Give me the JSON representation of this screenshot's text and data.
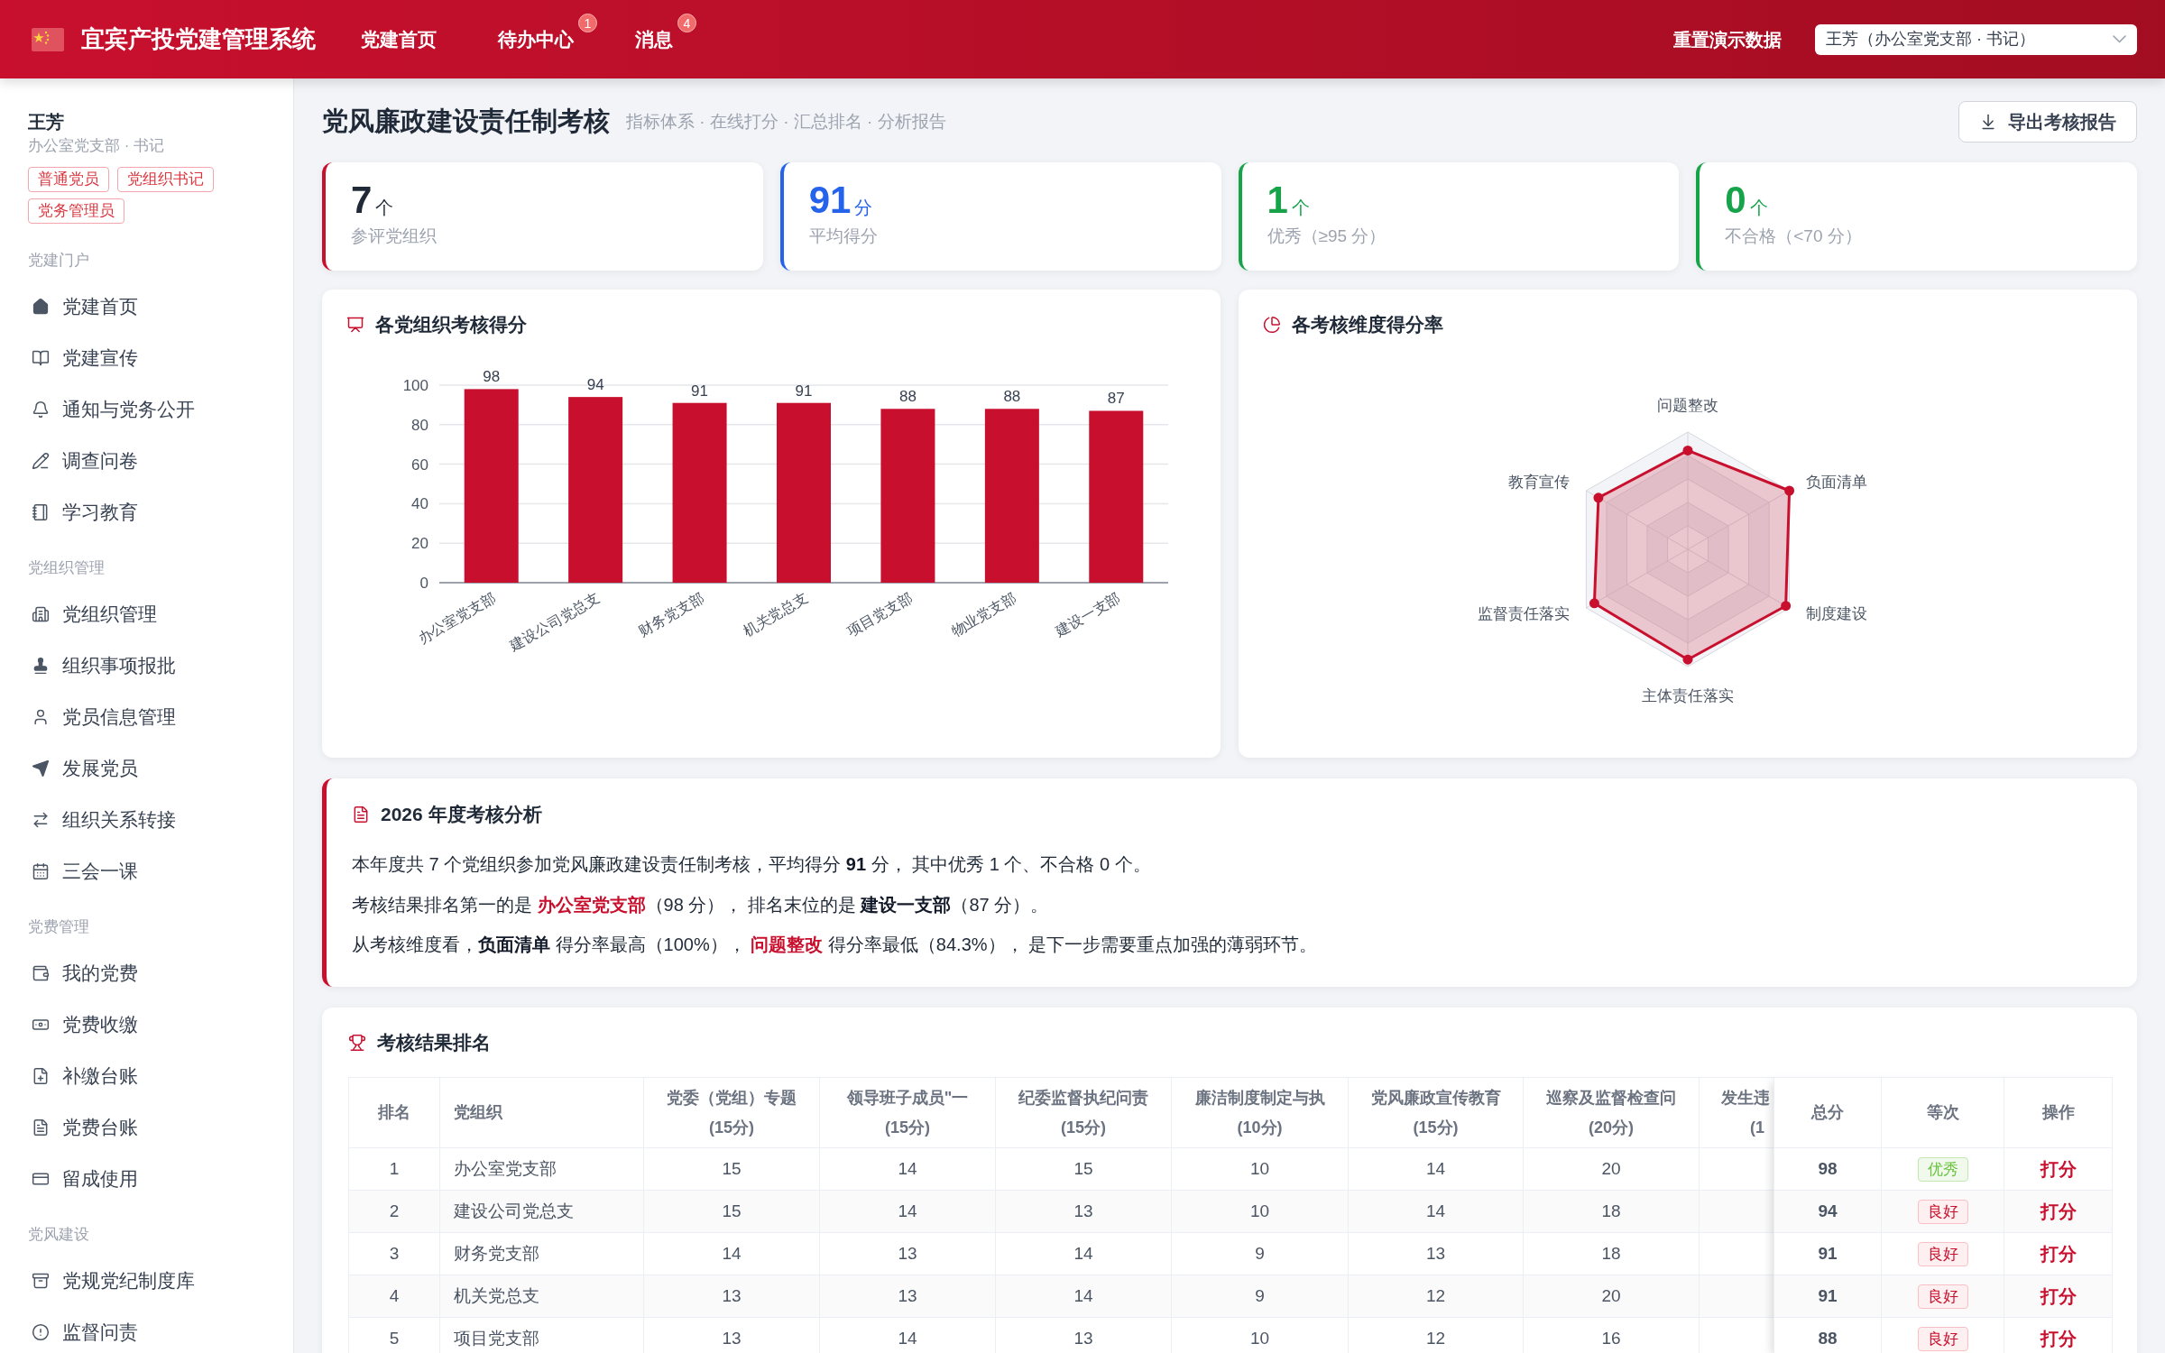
{
  "header": {
    "title": "宜宾产投党建管理系统",
    "nav": [
      {
        "label": "党建首页"
      },
      {
        "label": "待办中心",
        "badge": "1"
      },
      {
        "label": "消息",
        "badge": "4"
      }
    ],
    "reset_button": "重置演示数据",
    "user_select": {
      "value": "王芳（办公室党支部 · 书记）"
    }
  },
  "sidebar": {
    "user": {
      "name": "王芳",
      "subtitle": "办公室党支部 · 书记",
      "roles": [
        "普通党员",
        "党组织书记",
        "党务管理员"
      ]
    },
    "sections": [
      {
        "title": "党建门户",
        "items": [
          {
            "label": "党建首页"
          },
          {
            "label": "党建宣传"
          },
          {
            "label": "通知与党务公开"
          },
          {
            "label": "调查问卷"
          },
          {
            "label": "学习教育"
          }
        ]
      },
      {
        "title": "党组织管理",
        "items": [
          {
            "label": "党组织管理"
          },
          {
            "label": "组织事项报批"
          },
          {
            "label": "党员信息管理"
          },
          {
            "label": "发展党员"
          },
          {
            "label": "组织关系转接"
          },
          {
            "label": "三会一课"
          }
        ]
      },
      {
        "title": "党费管理",
        "items": [
          {
            "label": "我的党费"
          },
          {
            "label": "党费收缴"
          },
          {
            "label": "补缴台账"
          },
          {
            "label": "党费台账"
          },
          {
            "label": "留成使用"
          }
        ]
      },
      {
        "title": "党风建设",
        "items": [
          {
            "label": "党规党纪制度库"
          },
          {
            "label": "监督问责"
          }
        ]
      }
    ]
  },
  "page": {
    "title": "党风廉政建设责任制考核",
    "subtitle": "指标体系 · 在线打分 · 汇总排名 · 分析报告",
    "export_button": "导出考核报告"
  },
  "stats": [
    {
      "value": "7",
      "unit": "个",
      "label": "参评党组织",
      "color": "#c8102e",
      "kind": "plain"
    },
    {
      "value": "91",
      "unit": "分",
      "label": "平均得分",
      "color": "#2563eb",
      "kind": "accent"
    },
    {
      "value": "1",
      "unit": "个",
      "label": "优秀（≥95 分）",
      "color": "#16a34a",
      "kind": "accent"
    },
    {
      "value": "0",
      "unit": "个",
      "label": "不合格（<70 分）",
      "color": "#16a34a",
      "kind": "accent"
    }
  ],
  "score_chart": {
    "title": "各党组织考核得分",
    "chart_data": {
      "type": "bar",
      "categories": [
        "办公室党支部",
        "建设公司党总支",
        "财务党支部",
        "机关党总支",
        "项目党支部",
        "物业党支部",
        "建设一支部"
      ],
      "series": [
        {
          "color": "#c8102e",
          "values": [
            98,
            94,
            91,
            91,
            88,
            88,
            87
          ]
        }
      ],
      "ylim": [
        0,
        100
      ],
      "yticks": [
        0,
        20,
        40,
        60,
        80,
        100
      ],
      "grid": true,
      "data_labels": true
    }
  },
  "dimension_chart": {
    "title": "各考核维度得分率",
    "axes": [
      "问题整改",
      "负面清单",
      "制度建设",
      "主体责任落实",
      "监督责任落实",
      "教育宣传"
    ]
  },
  "analysis": {
    "title": "2026 年度考核分析",
    "paragraphs": [
      [
        {
          "text": "本年度共 7 个党组织参加党风廉政建设责任制考核，平均得分 ",
          "kind": "plain"
        },
        {
          "text": "91",
          "kind": "bold"
        },
        {
          "text": " 分， 其中优秀 1 个、不合格 0 个。",
          "kind": "plain"
        }
      ],
      [
        {
          "text": "考核结果排名第一的是 ",
          "kind": "plain"
        },
        {
          "text": "办公室党支部",
          "kind": "highlight"
        },
        {
          "text": "（98 分）， 排名末位的是 ",
          "kind": "plain"
        },
        {
          "text": "建设一支部",
          "kind": "bold"
        },
        {
          "text": "（87 分）。",
          "kind": "plain"
        }
      ],
      [
        {
          "text": "从考核维度看，",
          "kind": "plain"
        },
        {
          "text": "负面清单",
          "kind": "bold"
        },
        {
          "text": " 得分率最高（100%）， ",
          "kind": "plain"
        },
        {
          "text": "问题整改",
          "kind": "highlight"
        },
        {
          "text": " 得分率最低（84.3%）， 是下一步需要重点加强的薄弱环节。",
          "kind": "plain"
        }
      ]
    ]
  },
  "ranking": {
    "title": "考核结果排名",
    "columns": [
      {
        "label": "排名"
      },
      {
        "label": "党组织"
      },
      {
        "label": "党委（党组）专题",
        "note": "(15分)"
      },
      {
        "label": "领导班子成员\"一",
        "note": "(15分)"
      },
      {
        "label": "纪委监督执纪问责",
        "note": "(15分)"
      },
      {
        "label": "廉洁制度制定与执",
        "note": "(10分)"
      },
      {
        "label": "党风廉政宣传教育",
        "note": "(15分)"
      },
      {
        "label": "巡察及监督检查问",
        "note": "(20分)"
      },
      {
        "label": "发生违",
        "note": "(1"
      }
    ],
    "pinned_columns": [
      {
        "label": "总分"
      },
      {
        "label": "等次"
      },
      {
        "label": "操作"
      }
    ],
    "rows": [
      {
        "rank": "1",
        "org": "办公室党支部",
        "scores": [
          "15",
          "14",
          "15",
          "10",
          "14",
          "20"
        ],
        "total": "98",
        "grade": {
          "text": "优秀",
          "kind": "excellent"
        },
        "action": "打分"
      },
      {
        "rank": "2",
        "org": "建设公司党总支",
        "scores": [
          "15",
          "14",
          "13",
          "10",
          "14",
          "18"
        ],
        "total": "94",
        "grade": {
          "text": "良好",
          "kind": "good"
        },
        "action": "打分"
      },
      {
        "rank": "3",
        "org": "财务党支部",
        "scores": [
          "14",
          "13",
          "14",
          "9",
          "13",
          "18"
        ],
        "total": "91",
        "grade": {
          "text": "良好",
          "kind": "good"
        },
        "action": "打分"
      },
      {
        "rank": "4",
        "org": "机关党总支",
        "scores": [
          "13",
          "13",
          "14",
          "9",
          "12",
          "20"
        ],
        "total": "91",
        "grade": {
          "text": "良好",
          "kind": "good"
        },
        "action": "打分"
      },
      {
        "rank": "5",
        "org": "项目党支部",
        "scores": [
          "13",
          "14",
          "13",
          "10",
          "12",
          "16"
        ],
        "total": "88",
        "grade": {
          "text": "良好",
          "kind": "good"
        },
        "action": "打分"
      }
    ]
  }
}
